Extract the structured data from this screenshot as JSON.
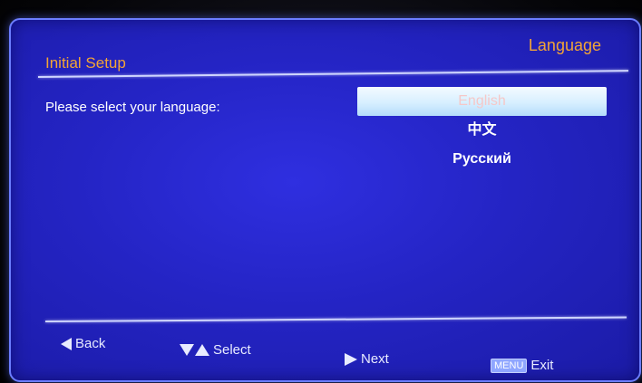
{
  "header": {
    "title": "Initial Setup",
    "section": "Language"
  },
  "prompt": "Please select your language:",
  "languages": {
    "selected_index": 0,
    "items": [
      "English",
      "中文",
      "Русский"
    ]
  },
  "footer": {
    "back": "Back",
    "select": "Select",
    "next": "Next",
    "menu_key": "MENU",
    "exit": "Exit"
  },
  "colors": {
    "background": "#2424c4",
    "title_accent": "#f2a437",
    "highlight": "#d7efff"
  }
}
